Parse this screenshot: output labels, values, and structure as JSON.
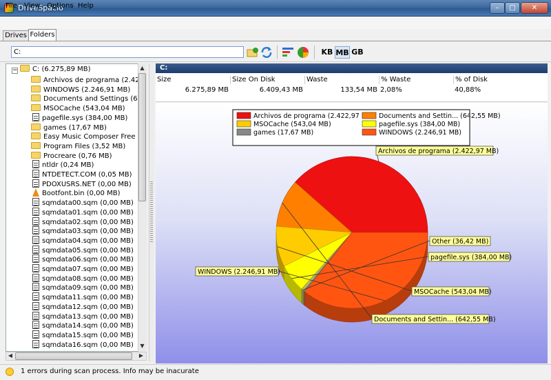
{
  "window": {
    "title": "DriveSpacio",
    "minimize": "–",
    "maximize": "□",
    "close": "✕"
  },
  "menu": [
    "File",
    "View",
    "Options",
    "Help"
  ],
  "tabs": {
    "drives": "Drives",
    "folders": "Folders"
  },
  "toolbar": {
    "path_value": "C:",
    "units": [
      "KB",
      "MB",
      "GB"
    ],
    "active_unit": "MB"
  },
  "tree": {
    "root": "C: (6.275,89 MB)",
    "items": [
      {
        "icon": "folder",
        "label": "Archivos de programa (2.422,97"
      },
      {
        "icon": "folder",
        "label": "WINDOWS (2.246,91 MB)"
      },
      {
        "icon": "folder",
        "label": "Documents and Settings (642,55"
      },
      {
        "icon": "folder",
        "label": "MSOCache (543,04 MB)"
      },
      {
        "icon": "doc",
        "label": "pagefile.sys (384,00 MB)"
      },
      {
        "icon": "folder",
        "label": "games (17,67 MB)"
      },
      {
        "icon": "folder",
        "label": "Easy Music Composer Free (14,1"
      },
      {
        "icon": "folder",
        "label": "Program Files (3,52 MB)"
      },
      {
        "icon": "folder",
        "label": "Procreare (0,76 MB)"
      },
      {
        "icon": "doc",
        "label": "ntldr (0,24 MB)"
      },
      {
        "icon": "doc",
        "label": "NTDETECT.COM (0,05 MB)"
      },
      {
        "icon": "doc",
        "label": "PDOXUSRS.NET (0,00 MB)"
      },
      {
        "icon": "cone",
        "label": "Bootfont.bin (0,00 MB)"
      },
      {
        "icon": "doc",
        "label": "sqmdata00.sqm (0,00 MB)"
      },
      {
        "icon": "doc",
        "label": "sqmdata01.sqm (0,00 MB)"
      },
      {
        "icon": "doc",
        "label": "sqmdata02.sqm (0,00 MB)"
      },
      {
        "icon": "doc",
        "label": "sqmdata03.sqm (0,00 MB)"
      },
      {
        "icon": "doc",
        "label": "sqmdata04.sqm (0,00 MB)"
      },
      {
        "icon": "doc",
        "label": "sqmdata05.sqm (0,00 MB)"
      },
      {
        "icon": "doc",
        "label": "sqmdata06.sqm (0,00 MB)"
      },
      {
        "icon": "doc",
        "label": "sqmdata07.sqm (0,00 MB)"
      },
      {
        "icon": "doc",
        "label": "sqmdata08.sqm (0,00 MB)"
      },
      {
        "icon": "doc",
        "label": "sqmdata09.sqm (0,00 MB)"
      },
      {
        "icon": "doc",
        "label": "sqmdata11.sqm (0,00 MB)"
      },
      {
        "icon": "doc",
        "label": "sqmdata12.sqm (0,00 MB)"
      },
      {
        "icon": "doc",
        "label": "sqmdata13.sqm (0,00 MB)"
      },
      {
        "icon": "doc",
        "label": "sqmdata14.sqm (0,00 MB)"
      },
      {
        "icon": "doc",
        "label": "sqmdata15.sqm (0,00 MB)"
      },
      {
        "icon": "doc",
        "label": "sqmdata16.sqm (0,00 MB)"
      }
    ]
  },
  "details": {
    "drive": "C:",
    "headers": [
      "Size",
      "Size On Disk",
      "Waste",
      "% Waste",
      "% of Disk"
    ],
    "values": [
      "6.275,89 MB",
      "6.409,43 MB",
      "133,54 MB",
      "2,08%",
      "40,88%"
    ]
  },
  "chart_data": {
    "type": "pie",
    "slices": [
      {
        "label": "Archivos de programa (2.422,97 MB)",
        "legend": "Archivos de programa (2.422,97 MB)",
        "value": 2422.97,
        "color": "#ee1111"
      },
      {
        "label": "Documents and Settin... (642,55 MB)",
        "legend": "Documents and Settin... (642,55 MB)",
        "value": 642.55,
        "color": "#ff8000"
      },
      {
        "label": "MSOCache (543,04 MB)",
        "legend": "MSOCache (543,04 MB)",
        "value": 543.04,
        "color": "#ffcc00"
      },
      {
        "label": "pagefile.sys (384,00 MB)",
        "legend": "pagefile.sys (384,00 MB)",
        "value": 384.0,
        "color": "#ffff00"
      },
      {
        "label": "Other (36,42 MB)",
        "legend": "",
        "value": 36.42,
        "color": "#bbbb55"
      },
      {
        "label": "",
        "legend": "games (17,67 MB)",
        "value": 17.67,
        "color": "#888888"
      },
      {
        "label": "WINDOWS (2.246,91 MB)",
        "legend": "WINDOWS (2.246,91 MB)",
        "value": 2246.91,
        "color": "#ff5511"
      }
    ]
  },
  "status": {
    "text": "1 errors during scan process. Info may be inacurate"
  }
}
